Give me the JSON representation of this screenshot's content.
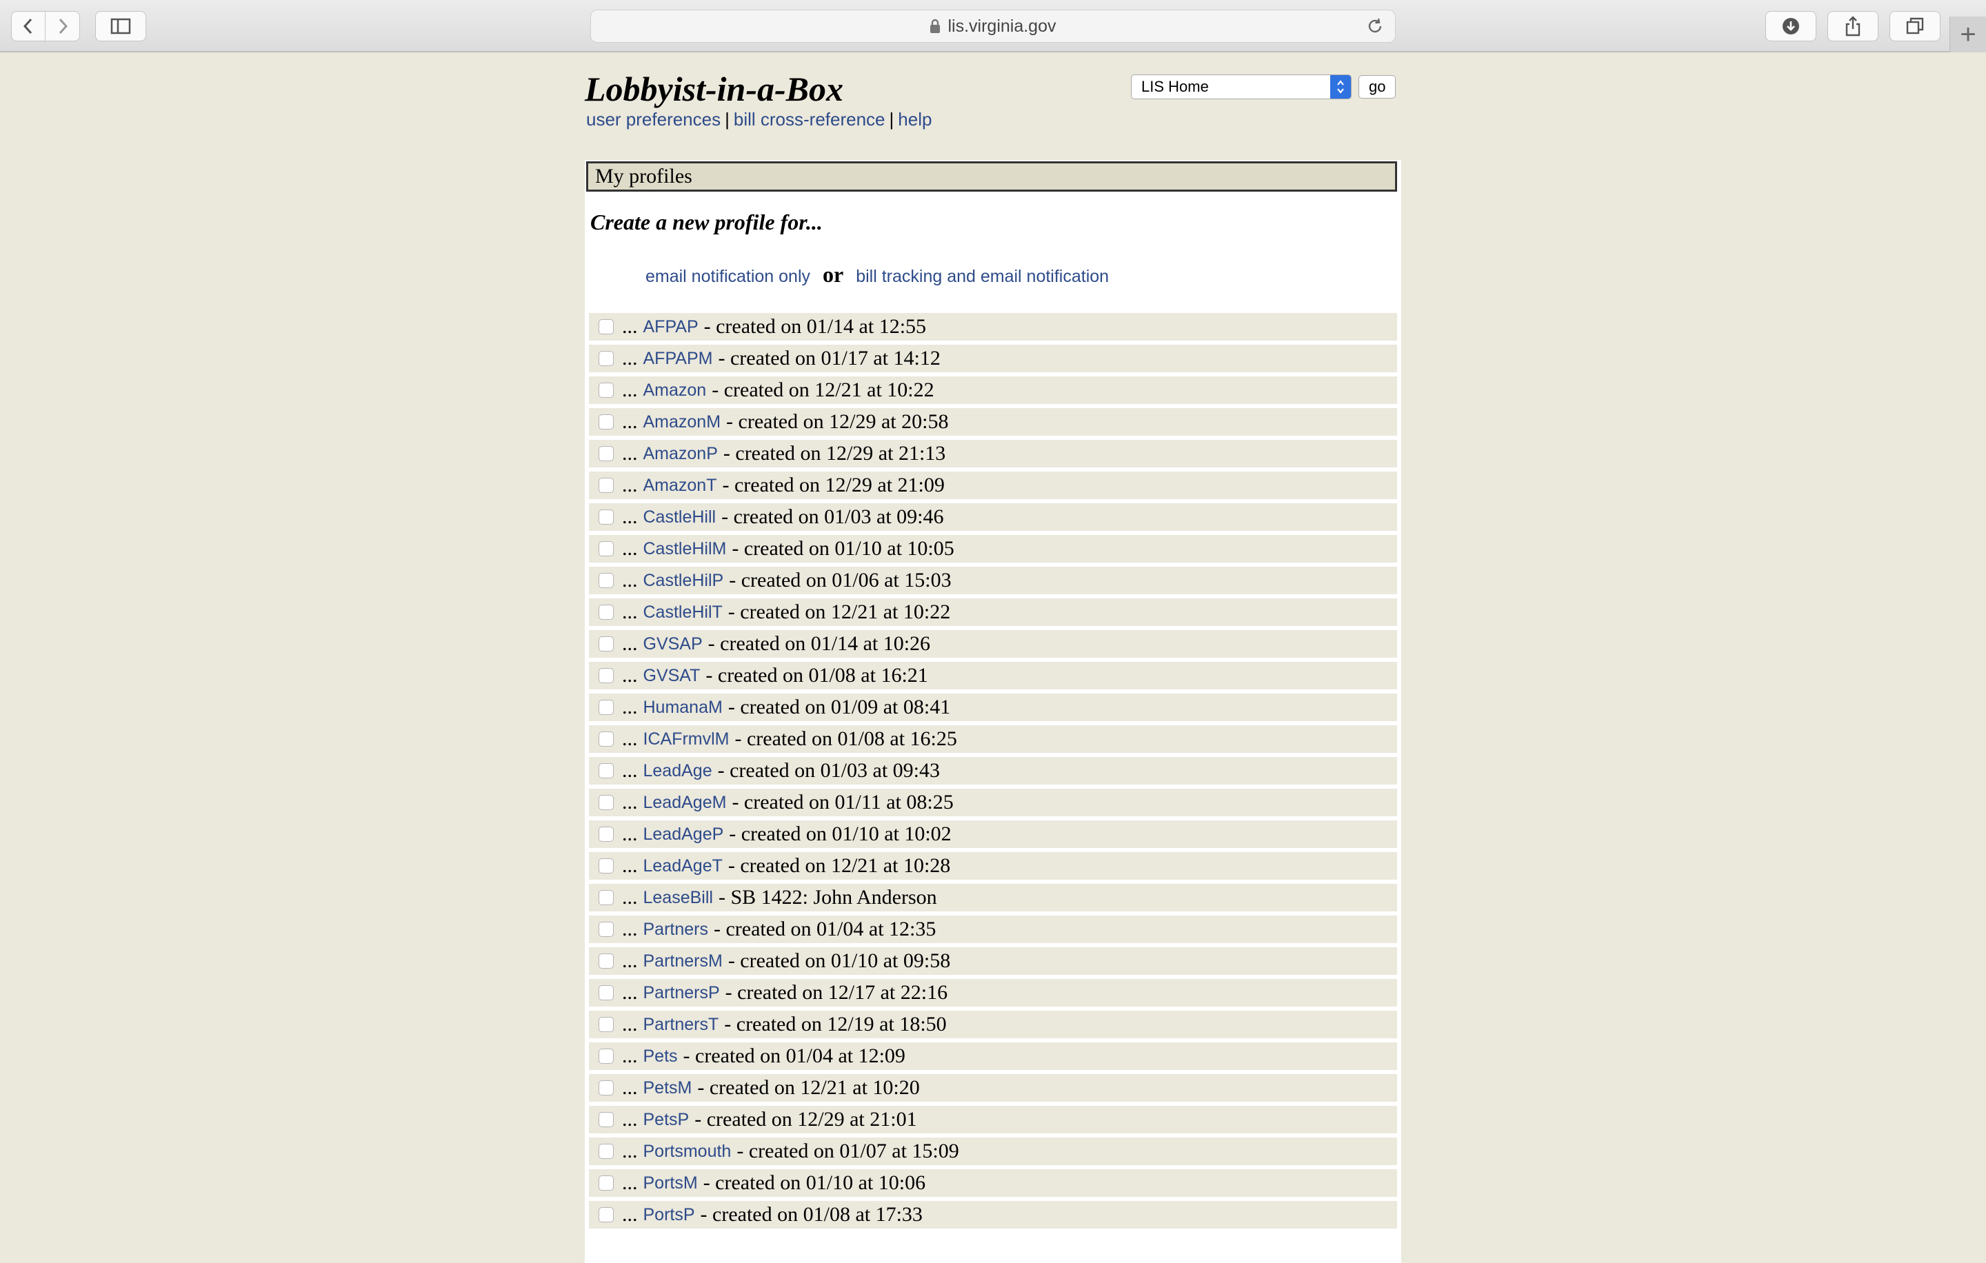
{
  "browser": {
    "url": "lis.virginia.gov",
    "icons": {
      "back": "chevron-left-icon",
      "forward": "chevron-right-icon",
      "sidebar": "sidebar-icon",
      "lock": "lock-icon",
      "reload": "reload-icon",
      "downloads": "download-icon",
      "share": "share-icon",
      "tabs": "tabs-icon",
      "new_tab": "plus-icon"
    },
    "new_tab_label": "+"
  },
  "header": {
    "title": "Lobbyist-in-a-Box",
    "links": [
      {
        "label": "user preferences"
      },
      {
        "label": "bill cross-reference"
      },
      {
        "label": "help"
      }
    ],
    "separator": "|",
    "jump_select_value": "LIS Home",
    "go_label": "go"
  },
  "main": {
    "section_title": "My profiles",
    "create_title": "Create a new profile for...",
    "create_option_1": "email notification only",
    "create_or": "or",
    "create_option_2": "bill tracking and email notification",
    "prefix": "...",
    "profiles": [
      {
        "name": "AFPAP",
        "desc": "- created on 01/14 at 12:55"
      },
      {
        "name": "AFPAPM",
        "desc": "- created on 01/17 at 14:12"
      },
      {
        "name": "Amazon",
        "desc": "- created on 12/21 at 10:22"
      },
      {
        "name": "AmazonM",
        "desc": "- created on 12/29 at 20:58"
      },
      {
        "name": "AmazonP",
        "desc": "- created on 12/29 at 21:13"
      },
      {
        "name": "AmazonT",
        "desc": "- created on 12/29 at 21:09"
      },
      {
        "name": "CastleHill",
        "desc": "- created on 01/03 at 09:46"
      },
      {
        "name": "CastleHilM",
        "desc": "- created on 01/10 at 10:05"
      },
      {
        "name": "CastleHilP",
        "desc": "- created on 01/06 at 15:03"
      },
      {
        "name": "CastleHilT",
        "desc": "- created on 12/21 at 10:22"
      },
      {
        "name": "GVSAP",
        "desc": "- created on 01/14 at 10:26"
      },
      {
        "name": "GVSAT",
        "desc": "- created on 01/08 at 16:21"
      },
      {
        "name": "HumanaM",
        "desc": "- created on 01/09 at 08:41"
      },
      {
        "name": "ICAFrmvlM",
        "desc": "- created on 01/08 at 16:25"
      },
      {
        "name": "LeadAge",
        "desc": "- created on 01/03 at 09:43"
      },
      {
        "name": "LeadAgeM",
        "desc": "- created on 01/11 at 08:25"
      },
      {
        "name": "LeadAgeP",
        "desc": "- created on 01/10 at 10:02"
      },
      {
        "name": "LeadAgeT",
        "desc": "- created on 12/21 at 10:28"
      },
      {
        "name": "LeaseBill",
        "desc": "- SB 1422: John Anderson"
      },
      {
        "name": "Partners",
        "desc": "- created on 01/04 at 12:35"
      },
      {
        "name": "PartnersM",
        "desc": "- created on 01/10 at 09:58"
      },
      {
        "name": "PartnersP",
        "desc": "- created on 12/17 at 22:16"
      },
      {
        "name": "PartnersT",
        "desc": "- created on 12/19 at 18:50"
      },
      {
        "name": "Pets",
        "desc": "- created on 01/04 at 12:09"
      },
      {
        "name": "PetsM",
        "desc": "- created on 12/21 at 10:20"
      },
      {
        "name": "PetsP",
        "desc": "- created on 12/29 at 21:01"
      },
      {
        "name": "Portsmouth",
        "desc": "- created on 01/07 at 15:09"
      },
      {
        "name": "PortsM",
        "desc": "- created on 01/10 at 10:06"
      },
      {
        "name": "PortsP",
        "desc": "- created on 01/08 at 17:33"
      }
    ]
  }
}
